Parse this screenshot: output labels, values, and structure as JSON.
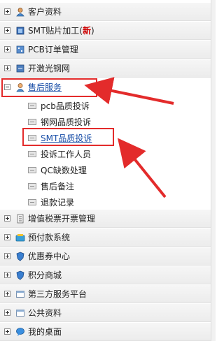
{
  "menu": {
    "top_items": [
      {
        "label": "客户资料",
        "icon": "person-icon"
      },
      {
        "label": "SMT贴片加工",
        "badge": "新",
        "icon": "chip-icon"
      },
      {
        "label": "PCB订单管理",
        "icon": "pcb-icon"
      },
      {
        "label": "开激光钢网",
        "icon": "stencil-icon"
      },
      {
        "label": "售后服务",
        "icon": "person-icon",
        "expanded": true,
        "selected": true
      }
    ],
    "after_sales_children": [
      {
        "label": "pcb品质投诉"
      },
      {
        "label": "钢网品质投诉"
      },
      {
        "label": "SMT品质投诉",
        "selected": true
      },
      {
        "label": "投诉工作人员"
      },
      {
        "label": "QC缺数处理"
      },
      {
        "label": "售后备注"
      },
      {
        "label": "退款记录"
      }
    ],
    "bottom_items": [
      {
        "label": "增值税票开票管理",
        "icon": "invoice-icon"
      },
      {
        "label": "预付款系统",
        "icon": "wallet-icon"
      },
      {
        "label": "优惠券中心",
        "icon": "shield-icon"
      },
      {
        "label": "积分商城",
        "icon": "shield-icon"
      },
      {
        "label": "第三方服务平台",
        "icon": "window-icon"
      },
      {
        "label": "公共资料",
        "icon": "window-icon"
      },
      {
        "label": "我的桌面",
        "icon": "chat-icon"
      }
    ]
  },
  "annotations": {
    "highlight_color": "#e32b2b"
  }
}
